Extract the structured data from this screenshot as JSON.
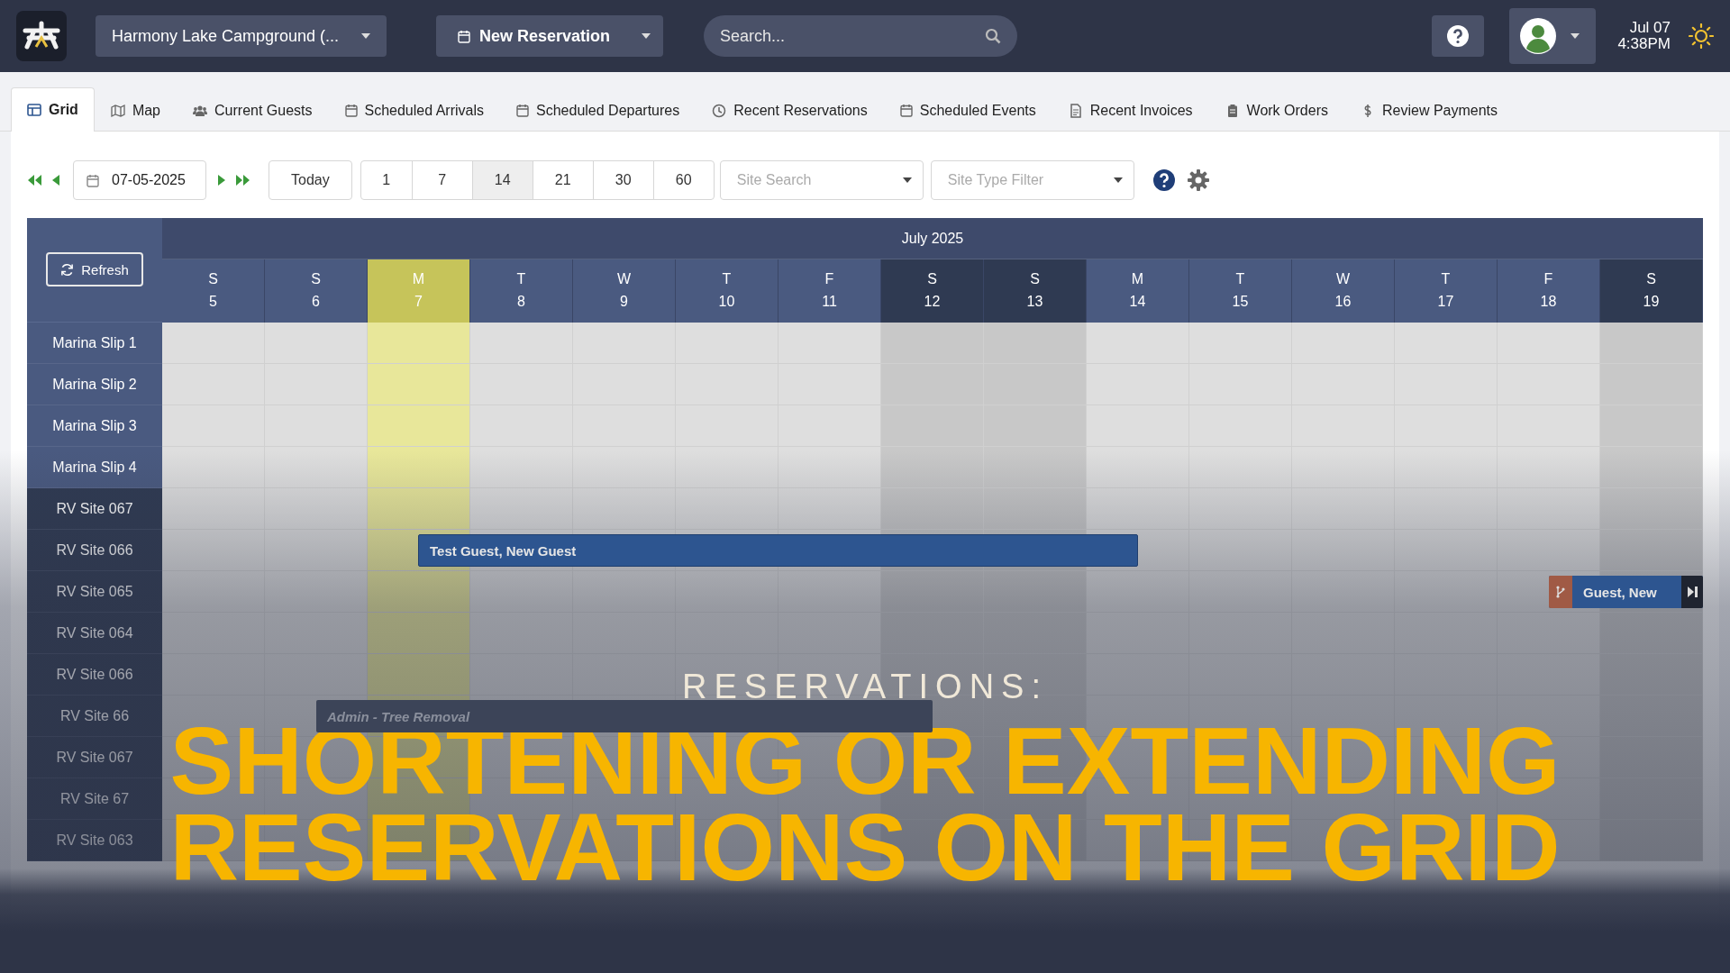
{
  "topbar": {
    "park": "Harmony Lake Campground (...",
    "new_button": "New Reservation",
    "search": {
      "placeholder": "Search..."
    },
    "date": "Jul 07",
    "time": "4:38PM"
  },
  "tabs": [
    {
      "label": "Grid",
      "selected": true
    },
    {
      "label": "Map",
      "selected": false
    },
    {
      "label": "Current Guests",
      "selected": false
    },
    {
      "label": "Scheduled Arrivals",
      "selected": false
    },
    {
      "label": "Scheduled Departures",
      "selected": false
    },
    {
      "label": "Recent Reservations",
      "selected": false
    },
    {
      "label": "Scheduled Events",
      "selected": false
    },
    {
      "label": "Recent Invoices",
      "selected": false
    },
    {
      "label": "Work Orders",
      "selected": false
    },
    {
      "label": "Review Payments",
      "selected": false
    }
  ],
  "toolbar": {
    "date": "07-05-2025",
    "today": "Today",
    "periods": [
      {
        "label": "1",
        "selected": false
      },
      {
        "label": "7",
        "selected": false
      },
      {
        "label": "14",
        "selected": true
      },
      {
        "label": "21",
        "selected": false
      },
      {
        "label": "30",
        "selected": false
      },
      {
        "label": "60",
        "selected": false
      }
    ],
    "site_search": {
      "placeholder": "Site Search"
    },
    "type_filter": {
      "placeholder": "Site Type Filter"
    }
  },
  "grid": {
    "refresh": "Refresh",
    "month": "July 2025",
    "days": [
      {
        "letter": "S",
        "number": "5",
        "today": false,
        "shaded": false
      },
      {
        "letter": "S",
        "number": "6",
        "today": false,
        "shaded": false
      },
      {
        "letter": "M",
        "number": "7",
        "today": true,
        "shaded": false
      },
      {
        "letter": "T",
        "number": "8",
        "today": false,
        "shaded": false
      },
      {
        "letter": "W",
        "number": "9",
        "today": false,
        "shaded": false
      },
      {
        "letter": "T",
        "number": "10",
        "today": false,
        "shaded": false
      },
      {
        "letter": "F",
        "number": "11",
        "today": false,
        "shaded": false
      },
      {
        "letter": "S",
        "number": "12",
        "today": false,
        "shaded": true
      },
      {
        "letter": "S",
        "number": "13",
        "today": false,
        "shaded": true
      },
      {
        "letter": "M",
        "number": "14",
        "today": false,
        "shaded": false
      },
      {
        "letter": "T",
        "number": "15",
        "today": false,
        "shaded": false
      },
      {
        "letter": "W",
        "number": "16",
        "today": false,
        "shaded": false
      },
      {
        "letter": "T",
        "number": "17",
        "today": false,
        "shaded": false
      },
      {
        "letter": "F",
        "number": "18",
        "today": false,
        "shaded": false
      },
      {
        "letter": "S",
        "number": "19",
        "today": false,
        "shaded": true
      }
    ],
    "rows": [
      {
        "site": "Marina Slip 1",
        "kind": "marina"
      },
      {
        "site": "Marina Slip 2",
        "kind": "marina"
      },
      {
        "site": "Marina Slip 3",
        "kind": "marina"
      },
      {
        "site": "Marina Slip 4",
        "kind": "marina"
      },
      {
        "site": "RV Site 067",
        "kind": "rv"
      },
      {
        "site": "RV Site 066",
        "kind": "rv",
        "reservations": [
          {
            "kind": "plain",
            "name": "Test Guest, New Guest"
          }
        ]
      },
      {
        "site": "RV Site 065",
        "kind": "rv",
        "reservations": [
          {
            "kind": "split",
            "name": "Guest, New"
          }
        ]
      },
      {
        "site": "RV Site 064",
        "kind": "rv"
      },
      {
        "site": "RV Site 066",
        "kind": "rv"
      },
      {
        "site": "RV Site 66",
        "kind": "rv",
        "reservations": [
          {
            "kind": "block",
            "name": "Admin - Tree Removal"
          }
        ]
      },
      {
        "site": "RV Site 067",
        "kind": "rv"
      },
      {
        "site": "RV Site 67",
        "kind": "rv"
      },
      {
        "site": "RV Site 063",
        "kind": "rv"
      }
    ]
  },
  "banner": {
    "kicker": "RESERVATIONS:",
    "title_lines": [
      "SHORTENING OR EXTENDING",
      "RESERVATIONS ON THE GRID"
    ]
  }
}
